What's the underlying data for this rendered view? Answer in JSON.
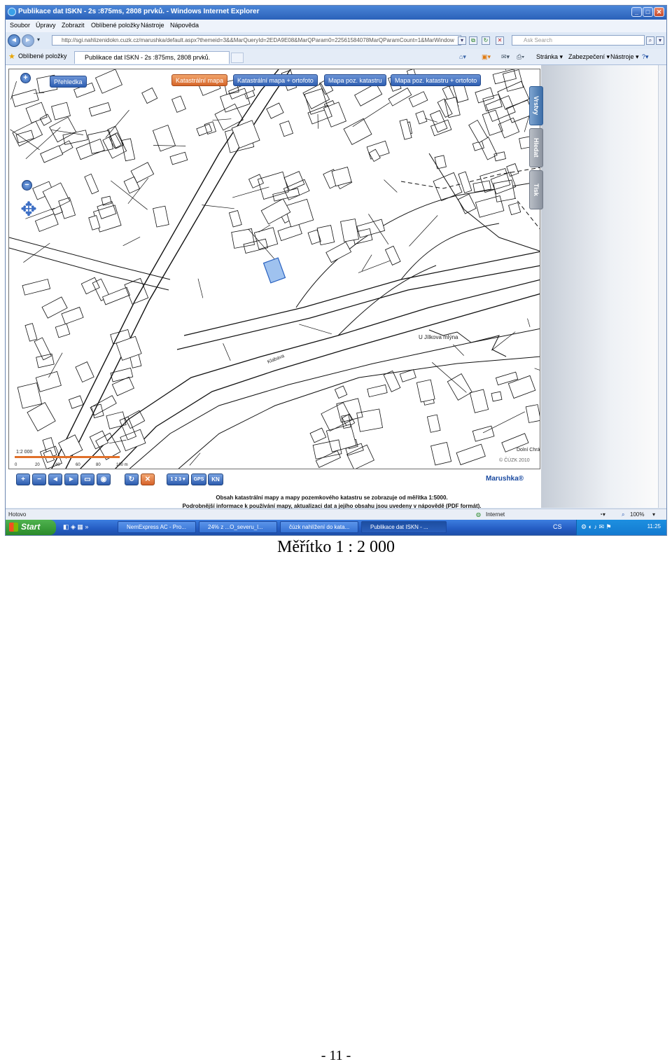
{
  "window": {
    "title": "Publikace dat ISKN - 2s :875ms, 2808 prvků. - Windows Internet Explorer",
    "controls": [
      "_",
      "□",
      "✕"
    ]
  },
  "menu": [
    "Soubor",
    "Úpravy",
    "Zobrazit",
    "Oblíbené položky",
    "Nástroje",
    "Nápověda"
  ],
  "address": {
    "url": "http://sgi.nahlizenidokn.cuzk.cz/marushka/default.aspx?themeid=3&&MarQueryId=2EDA9E08&MarQParam0=22561584078MarQParamCount=1&MarWindow",
    "search_placeholder": "Ask Search"
  },
  "favorites_label": "Oblíbené položky",
  "tab_title": "Publikace dat ISKN - 2s :875ms, 2808 prvků.",
  "command_bar": [
    "Stránka ▾",
    "Zabezpečení ▾",
    "Nástroje ▾",
    "?▾"
  ],
  "map": {
    "overview_button": "Přehledka",
    "tabs": [
      "Katastrální mapa",
      "Katastrální mapa + ortofoto",
      "Mapa poz. katastru",
      "Mapa poz. katastru + ortofoto"
    ],
    "active_tab": "Katastrální mapa",
    "side_tabs": [
      "Vrstvy",
      "Hledat",
      "Tisk"
    ],
    "scale_text": "1:2 000",
    "scale_ticks": [
      "0",
      "20",
      "40",
      "60",
      "80",
      "100 m"
    ],
    "place_labels": [
      "U Jílkova mlýna",
      "Klabava",
      "Dolní Chrá"
    ],
    "copyright": "© ČÚZK 2010",
    "tool_labels": [
      "+",
      "−",
      "◄",
      "►",
      "▭",
      "◉",
      "↻",
      "✕",
      "1 2 3 ▾",
      "GPS",
      "KN"
    ],
    "brand": "Marushka®",
    "info_line1": "Obsah katastrální mapy a mapy pozemkového katastru se zobrazuje od měřítka 1:5000.",
    "info_line2": "Podrobnější informace k používání mapy, aktualizaci dat a jejího obsahu jsou uvedeny v nápovědě (PDF formát)."
  },
  "statusbar": {
    "left": "Hotovo",
    "zone": "Internet",
    "zoom": "100%"
  },
  "taskbar": {
    "start": "Start",
    "items": [
      "NemExpress AC - Pro...",
      "24% z ...O_severu_l...",
      "čúzk nahlížení do kata...",
      "Publikace dat ISKN - ..."
    ],
    "active_index": 3,
    "lang": "CS",
    "clock": "11:25"
  },
  "caption": "Měřítko 1 : 2 000",
  "page_number": "- 11 -"
}
